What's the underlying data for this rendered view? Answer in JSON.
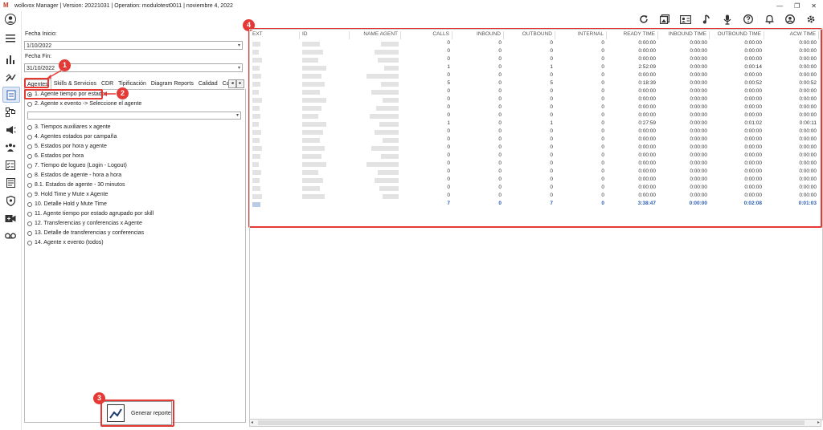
{
  "window": {
    "title": "wolkvox Manager  | Version: 20221031  |  Operation: modulotest0011  |  noviembre 4, 2022",
    "minimize": "—",
    "restore": "❐",
    "close": "✕"
  },
  "filters": {
    "start_label": "Fecha Inicio:",
    "start_value": "1/10/2022",
    "end_label": "Fecha Fin:",
    "end_value": "31/10/2022"
  },
  "tabs": [
    "Agentes",
    "Skills & Servicios",
    "CDR",
    "Tipificación",
    "Diagram Reports",
    "Calidad",
    "Cam"
  ],
  "options": [
    "1. Agente tiempo por estado",
    "2. Agente x evento -> Seleccione el agente",
    "3. Tiempos auxiliares x agente",
    "4. Agentes estados por campaña",
    "5. Estados por hora y agente",
    "6. Estados por hora",
    "7. Tiempo de logueo (Login - Logout)",
    "8. Estados de agente - hora a hora",
    "8.1. Estados de agente - 30 minutos",
    "9. Hold Time y Mute x Agente",
    "10. Detalle Hold y Mute Time",
    "11. Agente tiempo por estado agrupado por skill",
    "12. Transferencias y conferencias x Agente",
    "13. Detalle de transferencias y conferencias",
    "14. Agente x evento (todos)"
  ],
  "generate_label": "Generar reporte",
  "badges": [
    "1",
    "2",
    "3",
    "4"
  ],
  "table": {
    "headers": [
      "EXT",
      "ID",
      "NAME AGENT",
      "CALLS",
      "INBOUND",
      "OUTBOUND",
      "INTERNAL",
      "READY TIME",
      "INBOUND TIME",
      "OUTBOUND TIME",
      "ACW TIME"
    ],
    "rows": [
      [
        "0",
        "0",
        "0",
        "0",
        "0:00:00",
        "0:00:00",
        "0:00:00",
        "0:00:00"
      ],
      [
        "0",
        "0",
        "0",
        "0",
        "0:00:00",
        "0:00:00",
        "0:00:00",
        "0:00:00"
      ],
      [
        "0",
        "0",
        "0",
        "0",
        "0:00:00",
        "0:00:00",
        "0:00:00",
        "0:00:00"
      ],
      [
        "1",
        "0",
        "1",
        "0",
        "2:52:09",
        "0:00:00",
        "0:00:14",
        "0:00:00"
      ],
      [
        "0",
        "0",
        "0",
        "0",
        "0:00:00",
        "0:00:00",
        "0:00:00",
        "0:00:00"
      ],
      [
        "5",
        "0",
        "5",
        "0",
        "0:18:39",
        "0:00:00",
        "0:00:52",
        "0:00:52"
      ],
      [
        "0",
        "0",
        "0",
        "0",
        "0:00:00",
        "0:00:00",
        "0:00:00",
        "0:00:00"
      ],
      [
        "0",
        "0",
        "0",
        "0",
        "0:00:00",
        "0:00:00",
        "0:00:00",
        "0:00:00"
      ],
      [
        "0",
        "0",
        "0",
        "0",
        "0:00:00",
        "0:00:00",
        "0:00:00",
        "0:00:00"
      ],
      [
        "0",
        "0",
        "0",
        "0",
        "0:00:00",
        "0:00:00",
        "0:00:00",
        "0:00:00"
      ],
      [
        "1",
        "0",
        "1",
        "0",
        "0:27:59",
        "0:00:00",
        "0:01:02",
        "0:00:11"
      ],
      [
        "0",
        "0",
        "0",
        "0",
        "0:00:00",
        "0:00:00",
        "0:00:00",
        "0:00:00"
      ],
      [
        "0",
        "0",
        "0",
        "0",
        "0:00:00",
        "0:00:00",
        "0:00:00",
        "0:00:00"
      ],
      [
        "0",
        "0",
        "0",
        "0",
        "0:00:00",
        "0:00:00",
        "0:00:00",
        "0:00:00"
      ],
      [
        "0",
        "0",
        "0",
        "0",
        "0:00:00",
        "0:00:00",
        "0:00:00",
        "0:00:00"
      ],
      [
        "0",
        "0",
        "0",
        "0",
        "0:00:00",
        "0:00:00",
        "0:00:00",
        "0:00:00"
      ],
      [
        "0",
        "0",
        "0",
        "0",
        "0:00:00",
        "0:00:00",
        "0:00:00",
        "0:00:00"
      ],
      [
        "0",
        "0",
        "0",
        "0",
        "0:00:00",
        "0:00:00",
        "0:00:00",
        "0:00:00"
      ],
      [
        "0",
        "0",
        "0",
        "0",
        "0:00:00",
        "0:00:00",
        "0:00:00",
        "0:00:00"
      ],
      [
        "0",
        "0",
        "0",
        "0",
        "0:00:00",
        "0:00:00",
        "0:00:00",
        "0:00:00"
      ]
    ],
    "totals": [
      "7",
      "0",
      "7",
      "0",
      "3:38:47",
      "0:00:00",
      "0:02:08",
      "0:01:03"
    ]
  },
  "icons": {
    "sidebar": [
      "user-icon",
      "menu-icon",
      "bar-chart-icon",
      "trend-icon",
      "report-icon",
      "flow-icon",
      "campaign-icon",
      "team-icon",
      "checklist-icon",
      "document-icon",
      "security-icon",
      "video-icon",
      "voicemail-icon"
    ],
    "toolbar": [
      "refresh-icon",
      "gallery-icon",
      "id-card-icon",
      "music-icon",
      "microphone-icon",
      "help-icon",
      "bell-icon",
      "account-icon",
      "settings-icon"
    ]
  },
  "colors": {
    "highlight": "#e53935",
    "total_text": "#2a5db0",
    "active_nav": "#dfe8f6"
  }
}
